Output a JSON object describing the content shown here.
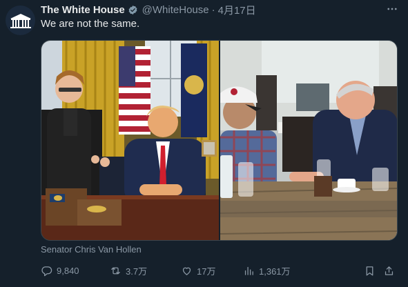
{
  "tweet": {
    "author_name": "The White House",
    "handle": "@WhiteHouse",
    "date": "4月17日",
    "text": "We are not the same.",
    "caption": "Senator Chris Van Hollen"
  },
  "actions": {
    "replies": "9,840",
    "reposts": "3.7万",
    "likes": "17万",
    "views": "1,361万"
  },
  "colors": {
    "background": "#15202b",
    "text": "#e7e9ea",
    "muted": "#8b98a5",
    "verified": "#829aab"
  },
  "icons": [
    "white-house-logo",
    "verified-badge-icon",
    "more-icon",
    "reply-icon",
    "repost-icon",
    "like-icon",
    "views-icon",
    "bookmark-icon",
    "share-icon"
  ]
}
